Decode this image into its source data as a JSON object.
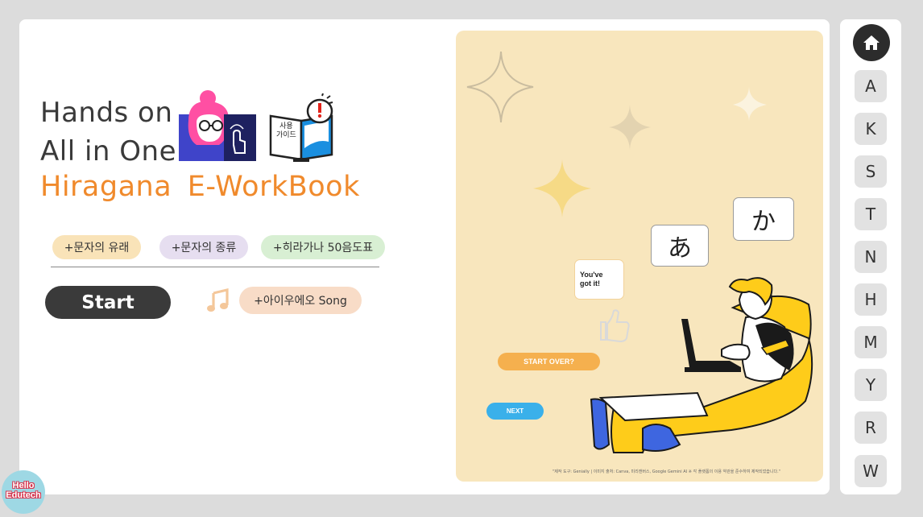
{
  "title": {
    "line1": "Hands on",
    "line2": "All in One",
    "line3": "Hiragana  E-WorkBook"
  },
  "guide_book": {
    "label_line1": "사용",
    "label_line2": "가이드"
  },
  "topics": [
    {
      "label": "+문자의 유래"
    },
    {
      "label": "+문자의 종류"
    },
    {
      "label": "+히라가나 50음도표"
    }
  ],
  "start_button": {
    "label": "Start"
  },
  "song_button": {
    "label": "+아이우에오 Song"
  },
  "panel": {
    "bubble_ka": "か",
    "bubble_a": "あ",
    "bubble_got_it": "You've got it!",
    "start_over_label": "START OVER?",
    "next_label": "NEXT",
    "credit": "\"제작 도구: Genially | 이미지 출처: Canva, 미리캔버스, Google Gemini AI ※ 각 플랫폼의 이용 약관을 준수하여 제작되었습니다.\""
  },
  "sidebar": {
    "home_icon": "home-icon",
    "items": [
      {
        "label": "A"
      },
      {
        "label": "K"
      },
      {
        "label": "S"
      },
      {
        "label": "T"
      },
      {
        "label": "N"
      },
      {
        "label": "H"
      },
      {
        "label": "M"
      },
      {
        "label": "Y"
      },
      {
        "label": "R"
      },
      {
        "label": "W"
      }
    ]
  },
  "logo": {
    "line1": "Hello",
    "line2": "Edutech"
  },
  "colors": {
    "accent_orange": "#f08a2c",
    "panel_bg": "#f8e6bd",
    "start_over": "#f5b04e",
    "next": "#3ab0ea",
    "dark": "#3a3a3a"
  }
}
